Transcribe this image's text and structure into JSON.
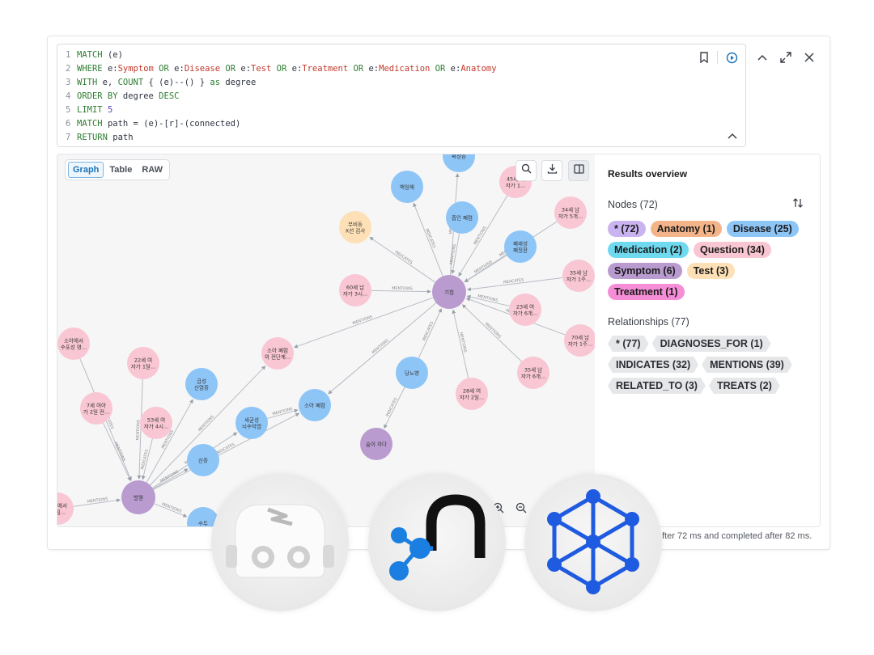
{
  "editor": {
    "lines": [
      {
        "n": "1",
        "parts": [
          {
            "t": "MATCH ",
            "c": "kw"
          },
          {
            "t": "(e)",
            "c": "plain"
          }
        ]
      },
      {
        "n": "2",
        "parts": [
          {
            "t": "WHERE ",
            "c": "kw"
          },
          {
            "t": "e:",
            "c": "plain"
          },
          {
            "t": "Symptom",
            "c": "lbl"
          },
          {
            "t": " OR ",
            "c": "kw"
          },
          {
            "t": "e:",
            "c": "plain"
          },
          {
            "t": "Disease",
            "c": "lbl"
          },
          {
            "t": " OR ",
            "c": "kw"
          },
          {
            "t": "e:",
            "c": "plain"
          },
          {
            "t": "Test",
            "c": "lbl"
          },
          {
            "t": " OR ",
            "c": "kw"
          },
          {
            "t": "e:",
            "c": "plain"
          },
          {
            "t": "Treatment",
            "c": "lbl"
          },
          {
            "t": " OR ",
            "c": "kw"
          },
          {
            "t": "e:",
            "c": "plain"
          },
          {
            "t": "Medication",
            "c": "lbl"
          },
          {
            "t": " OR ",
            "c": "kw"
          },
          {
            "t": "e:",
            "c": "plain"
          },
          {
            "t": "Anatomy",
            "c": "lbl"
          }
        ]
      },
      {
        "n": "3",
        "parts": [
          {
            "t": "WITH ",
            "c": "kw"
          },
          {
            "t": "e, ",
            "c": "plain"
          },
          {
            "t": "COUNT",
            "c": "kw"
          },
          {
            "t": " { (e)--() } ",
            "c": "plain"
          },
          {
            "t": "as ",
            "c": "kw"
          },
          {
            "t": "degree",
            "c": "plain"
          }
        ]
      },
      {
        "n": "4",
        "parts": [
          {
            "t": "ORDER BY ",
            "c": "kw"
          },
          {
            "t": "degree ",
            "c": "plain"
          },
          {
            "t": "DESC",
            "c": "kw"
          }
        ]
      },
      {
        "n": "5",
        "parts": [
          {
            "t": "LIMIT ",
            "c": "kw"
          },
          {
            "t": "5",
            "c": "num"
          }
        ]
      },
      {
        "n": "6",
        "parts": [
          {
            "t": "MATCH ",
            "c": "kw"
          },
          {
            "t": "path = (e)-[r]-(connected)",
            "c": "plain"
          }
        ]
      },
      {
        "n": "7",
        "parts": [
          {
            "t": "RETURN ",
            "c": "kw"
          },
          {
            "t": "path",
            "c": "plain"
          }
        ]
      }
    ]
  },
  "view_tabs": [
    "Graph",
    "Table",
    "RAW"
  ],
  "active_tab": "Graph",
  "results": {
    "title": "Results overview",
    "nodes_label": "Nodes (72)",
    "node_chips": [
      {
        "label": "* (72)",
        "color": "#c9b3f0"
      },
      {
        "label": "Anatomy (1)",
        "color": "#f4b48a"
      },
      {
        "label": "Disease (25)",
        "color": "#8ec5f7"
      },
      {
        "label": "Medication (2)",
        "color": "#6fd9ef"
      },
      {
        "label": "Question (34)",
        "color": "#f9c6d3"
      },
      {
        "label": "Symptom (6)",
        "color": "#b99bcf"
      },
      {
        "label": "Test (3)",
        "color": "#fde0b6"
      },
      {
        "label": "Treatment (1)",
        "color": "#f58ed6"
      }
    ],
    "rels_label": "Relationships (77)",
    "rel_chips": [
      "* (77)",
      "DIAGNOSES_FOR (1)",
      "INDICATES (32)",
      "MENTIONS (39)",
      "RELATED_TO (3)",
      "TREATS (2)"
    ]
  },
  "status_text": "fter 72 ms and completed after 82 ms.",
  "graph": {
    "nodes": [
      {
        "id": "a",
        "label": "확장증",
        "type": "Disease"
      },
      {
        "id": "b",
        "label": "백일해",
        "type": "Disease"
      },
      {
        "id": "c",
        "label": "45세 여\n자가 1...",
        "type": "Question"
      },
      {
        "id": "d",
        "label": "34세 남\n자가 5개...",
        "type": "Question"
      },
      {
        "id": "e",
        "label": "부비동\nX선 검사",
        "type": "Test"
      },
      {
        "id": "f",
        "label": "흡인 폐렴",
        "type": "Disease"
      },
      {
        "id": "g",
        "label": "폐쇄성\n폐질환",
        "type": "Disease"
      },
      {
        "id": "h",
        "label": "35세 남\n자가 1주...",
        "type": "Question"
      },
      {
        "id": "i",
        "label": "60세 남\n자가 3시...",
        "type": "Question"
      },
      {
        "id": "hub1",
        "label": "기침",
        "type": "Symptom"
      },
      {
        "id": "j",
        "label": "23세 여\n자가 6개...",
        "type": "Question"
      },
      {
        "id": "k",
        "label": "70세 남\n자가 1주...",
        "type": "Question"
      },
      {
        "id": "l",
        "label": "소아 폐렴\n의 전단계...",
        "type": "Question"
      },
      {
        "id": "m",
        "label": "소아에서\n수포성 명...",
        "type": "Question"
      },
      {
        "id": "n",
        "label": "22세 여\n자가 1달...",
        "type": "Question"
      },
      {
        "id": "o",
        "label": "당뇨병",
        "type": "Disease"
      },
      {
        "id": "p",
        "label": "35세 남\n자가 6개...",
        "type": "Question"
      },
      {
        "id": "q",
        "label": "28세 여\n자가 2일...",
        "type": "Question"
      },
      {
        "id": "r",
        "label": "급성\n신염증",
        "type": "Disease"
      },
      {
        "id": "s",
        "label": "7세 여아\n가 2일 전...",
        "type": "Question"
      },
      {
        "id": "t",
        "label": "53세 여\n자가 4시...",
        "type": "Question"
      },
      {
        "id": "u",
        "label": "세균성\n뇌수막염",
        "type": "Disease"
      },
      {
        "id": "v",
        "label": "소아 폐렴",
        "type": "Disease"
      },
      {
        "id": "w",
        "label": "숨이 차다",
        "type": "Symptom"
      },
      {
        "id": "x",
        "label": "신증",
        "type": "Disease"
      },
      {
        "id": "hub2",
        "label": "발열",
        "type": "Symptom"
      },
      {
        "id": "y",
        "label": "소아에서\n급 림...",
        "type": "Question"
      },
      {
        "id": "z",
        "label": "수두",
        "type": "Disease"
      }
    ],
    "edge_labels": [
      "DIAGNOSES_FOR",
      "MENTIONS",
      "INDICATES",
      "RELATED_TO"
    ]
  }
}
